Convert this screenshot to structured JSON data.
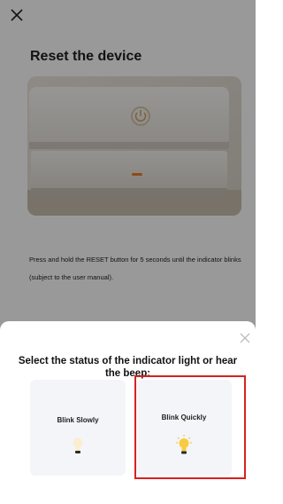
{
  "page": {
    "close_icon": "close-icon",
    "title": "Reset the device",
    "instruction": "Press and hold the RESET button for 5 seconds until the indicator blinks (subject to the user manual)."
  },
  "sheet": {
    "close_icon": "close-icon",
    "title": "Select the status of the indicator light or hear the beep:",
    "options": [
      {
        "label": "Blink Slowly",
        "icon": "bulb-dim-icon"
      },
      {
        "label": "Blink Quickly",
        "icon": "bulb-glowing-icon"
      }
    ],
    "highlight_color": "#d92020"
  }
}
